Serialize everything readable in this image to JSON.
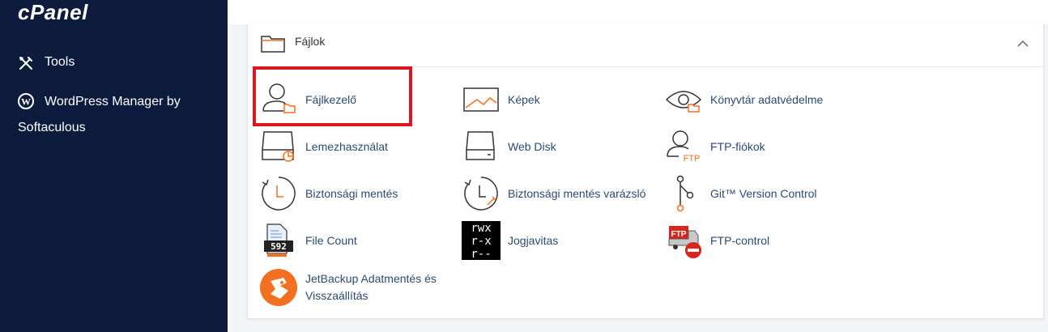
{
  "sidebar": {
    "logo": "cPanel",
    "items": [
      {
        "label": "Tools",
        "icon": "tools-icon"
      },
      {
        "label_line1": "WordPress Manager by",
        "label_line2": "Softaculous",
        "icon": "wordpress-icon"
      }
    ]
  },
  "panel": {
    "title": "Fájlok",
    "items": [
      {
        "label": "Fájlkezelő",
        "icon": "file-manager-icon"
      },
      {
        "label": "Képek",
        "icon": "images-icon"
      },
      {
        "label": "Könyvtár adatvédelme",
        "icon": "directory-privacy-icon"
      },
      {
        "label": "Lemezhasználat",
        "icon": "disk-usage-icon"
      },
      {
        "label": "Web Disk",
        "icon": "web-disk-icon"
      },
      {
        "label": "FTP-fiókok",
        "icon": "ftp-accounts-icon"
      },
      {
        "label": "Biztonsági mentés",
        "icon": "backup-icon"
      },
      {
        "label": "Biztonsági mentés varázsló",
        "icon": "backup-wizard-icon"
      },
      {
        "label": "Git™ Version Control",
        "icon": "git-icon"
      },
      {
        "label": "File Count",
        "icon": "file-count-icon"
      },
      {
        "label": "Jogjavitas",
        "icon": "permissions-icon"
      },
      {
        "label": "FTP-control",
        "icon": "ftp-control-icon"
      },
      {
        "label_line1": "JetBackup Adatmentés és",
        "label_line2": "Visszaállítás",
        "icon": "jetbackup-icon"
      }
    ],
    "ftp_text": "FTP",
    "perm_rows": [
      "rwx",
      "r-x",
      "r--"
    ],
    "file_count_digits": "592"
  },
  "colors": {
    "sidebar": "#0d1c3d",
    "accent": "#e0141f",
    "link": "#2c4a6e",
    "orange": "#f37021"
  }
}
